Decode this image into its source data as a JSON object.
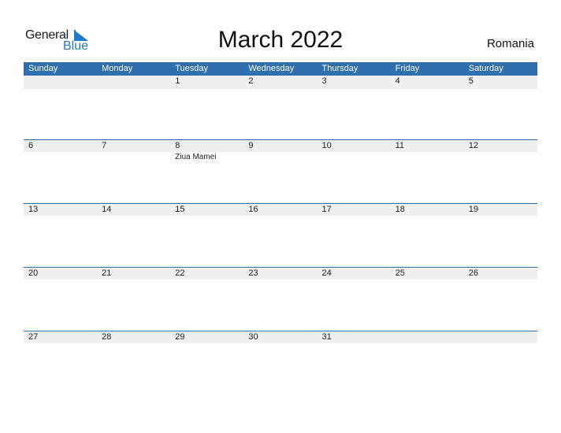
{
  "logo": {
    "line1": "General",
    "line2": "Blue"
  },
  "title": "March 2022",
  "country": "Romania",
  "colors": {
    "header": "#2f6fad",
    "row_fill": "#f0f0f0",
    "brand_blue": "#1e7ac6"
  },
  "weekdays": [
    "Sunday",
    "Monday",
    "Tuesday",
    "Wednesday",
    "Thursday",
    "Friday",
    "Saturday"
  ],
  "weeks": [
    {
      "days": [
        "",
        "",
        "1",
        "2",
        "3",
        "4",
        "5"
      ],
      "events": [
        "",
        "",
        "",
        "",
        "",
        "",
        ""
      ]
    },
    {
      "days": [
        "6",
        "7",
        "8",
        "9",
        "10",
        "11",
        "12"
      ],
      "events": [
        "",
        "",
        "Ziua Mamei",
        "",
        "",
        "",
        ""
      ]
    },
    {
      "days": [
        "13",
        "14",
        "15",
        "16",
        "17",
        "18",
        "19"
      ],
      "events": [
        "",
        "",
        "",
        "",
        "",
        "",
        ""
      ]
    },
    {
      "days": [
        "20",
        "21",
        "22",
        "23",
        "24",
        "25",
        "26"
      ],
      "events": [
        "",
        "",
        "",
        "",
        "",
        "",
        ""
      ]
    },
    {
      "days": [
        "27",
        "28",
        "29",
        "30",
        "31",
        "",
        ""
      ],
      "events": [
        "",
        "",
        "",
        "",
        "",
        "",
        ""
      ]
    }
  ]
}
